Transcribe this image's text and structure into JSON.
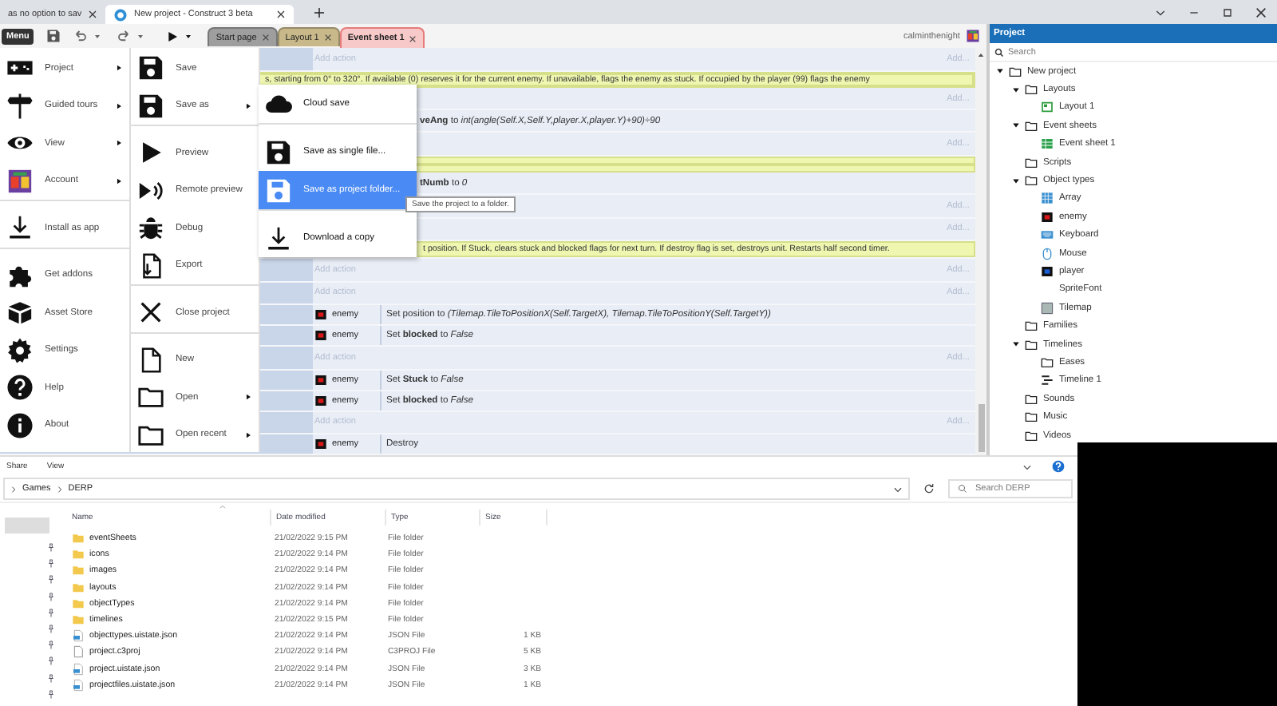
{
  "browser": {
    "tabs": [
      {
        "title": "as no option to sav",
        "selected": false
      },
      {
        "title": "New project - Construct 3 beta",
        "selected": true
      }
    ]
  },
  "toolbar": {
    "menu_label": "Menu",
    "user": "calminthenight",
    "tabs": [
      {
        "label": "Start page",
        "color": "#9e9e9e",
        "selected": false
      },
      {
        "label": "Layout 1",
        "color": "#c9b98a",
        "selected": false
      },
      {
        "label": "Event sheet 1",
        "color": "#f8c9c9",
        "selected": true
      }
    ]
  },
  "event_sheet": {
    "rows": [
      {
        "kind": "add",
        "label": "Add action",
        "more": "Add..."
      },
      {
        "kind": "comment",
        "text": "s, starting from 0° to 320°. If available (0) reserves it for the current enemy. If unavailable, flags the enemy as stuck. If occupied by the player (99) flags the enemy"
      },
      {
        "kind": "add",
        "more": "Add..."
      },
      {
        "kind": "action_clipped",
        "text": "**veAng** to *int(angle(Self.X,Self.Y,player.X,player.Y)+90)÷90*"
      },
      {
        "kind": "add",
        "more": "Add..."
      },
      {
        "kind": "comment"
      },
      {
        "kind": "action_clipped",
        "text": "**tNumb** to *0*"
      },
      {
        "kind": "add",
        "more": "Add..."
      },
      {
        "kind": "add",
        "more": "Add..."
      },
      {
        "kind": "comment_clipped",
        "text": "t position. If Stuck, clears stuck and blocked flags for next turn. If destroy flag is set, destroys unit. Restarts half second timer."
      },
      {
        "kind": "add",
        "label": "Add action",
        "more": "Add..."
      },
      {
        "kind": "add",
        "label": "Add action",
        "more": "Add..."
      },
      {
        "kind": "action",
        "object": "enemy",
        "text": "Set position to *(Tilemap.TileToPositionX(Self.TargetX), Tilemap.TileToPositionY(Self.TargetY))*"
      },
      {
        "kind": "action",
        "object": "enemy",
        "text": "Set **blocked** to *False*"
      },
      {
        "kind": "add",
        "label": "Add action",
        "more": "Add..."
      },
      {
        "kind": "action",
        "object": "enemy",
        "text": "Set **Stuck** to *False*"
      },
      {
        "kind": "action",
        "object": "enemy",
        "text": "Set **blocked** to *False*"
      },
      {
        "kind": "add",
        "label": "Add action",
        "more": "Add..."
      },
      {
        "kind": "action",
        "object": "enemy",
        "text": "Destroy"
      }
    ]
  },
  "main_menu": [
    {
      "label": "Project",
      "has_submenu": true
    },
    {
      "label": "Guided tours",
      "has_submenu": true
    },
    {
      "label": "View",
      "has_submenu": true
    },
    {
      "label": "Account",
      "has_submenu": true,
      "divider_after": true
    },
    {
      "label": "Install as app",
      "divider_after": true
    },
    {
      "label": "Get addons"
    },
    {
      "label": "Asset Store"
    },
    {
      "label": "Settings"
    },
    {
      "label": "Help"
    },
    {
      "label": "About"
    }
  ],
  "file_menu": [
    {
      "label": "Save"
    },
    {
      "label": "Save as",
      "has_submenu": true,
      "divider_after": true
    },
    {
      "label": "Preview"
    },
    {
      "label": "Remote preview"
    },
    {
      "label": "Debug"
    },
    {
      "label": "Export",
      "divider_after": true
    },
    {
      "label": "Close project",
      "divider_after": true
    },
    {
      "label": "New"
    },
    {
      "label": "Open",
      "has_submenu": true
    },
    {
      "label": "Open recent",
      "has_submenu": true
    }
  ],
  "save_as_menu": [
    {
      "label": "Cloud save",
      "selected": false,
      "divider_after": true
    },
    {
      "label": "Save as single file...",
      "selected": false
    },
    {
      "label": "Save as project folder...",
      "selected": true,
      "divider_after": true
    },
    {
      "label": "Download a copy",
      "selected": false
    }
  ],
  "tooltip": "Save the project to a folder.",
  "project_panel": {
    "title": "Project",
    "search_placeholder": "Search",
    "tree": [
      {
        "label": "New project",
        "kind": "folder",
        "expanded": true,
        "children": [
          {
            "label": "Layouts",
            "kind": "folder",
            "expanded": true,
            "children": [
              {
                "label": "Layout 1",
                "kind": "layout"
              }
            ]
          },
          {
            "label": "Event sheets",
            "kind": "folder",
            "expanded": true,
            "children": [
              {
                "label": "Event sheet 1",
                "kind": "eventsheet"
              }
            ]
          },
          {
            "label": "Scripts",
            "kind": "folder"
          },
          {
            "label": "Object types",
            "kind": "folder",
            "expanded": true,
            "children": [
              {
                "label": "Array",
                "kind": "array"
              },
              {
                "label": "enemy",
                "kind": "sprite",
                "color": "#d81818"
              },
              {
                "label": "Keyboard",
                "kind": "keyboard"
              },
              {
                "label": "Mouse",
                "kind": "mouse"
              },
              {
                "label": "player",
                "kind": "sprite",
                "color": "#1a5fd8"
              },
              {
                "label": "SpriteFont",
                "kind": "spritefont"
              },
              {
                "label": "Tilemap",
                "kind": "tilemap"
              }
            ]
          },
          {
            "label": "Families",
            "kind": "folder"
          },
          {
            "label": "Timelines",
            "kind": "folder",
            "expanded": true,
            "children": [
              {
                "label": "Eases",
                "kind": "folder"
              },
              {
                "label": "Timeline 1",
                "kind": "timeline"
              }
            ]
          },
          {
            "label": "Sounds",
            "kind": "folder"
          },
          {
            "label": "Music",
            "kind": "folder"
          },
          {
            "label": "Videos",
            "kind": "folder"
          }
        ]
      }
    ]
  },
  "explorer": {
    "ribbon": [
      "Share",
      "View"
    ],
    "path": [
      "Games",
      "DERP"
    ],
    "search_placeholder": "Search DERP",
    "columns": [
      "Name",
      "Date modified",
      "Type",
      "Size"
    ],
    "rows": [
      {
        "name": "eventSheets",
        "date": "21/02/2022 9:15 PM",
        "type": "File folder",
        "kind": "folder"
      },
      {
        "name": "icons",
        "date": "21/02/2022 9:14 PM",
        "type": "File folder",
        "kind": "folder"
      },
      {
        "name": "images",
        "date": "21/02/2022 9:14 PM",
        "type": "File folder",
        "kind": "folder"
      },
      {
        "name": "layouts",
        "date": "21/02/2022 9:14 PM",
        "type": "File folder",
        "kind": "folder"
      },
      {
        "name": "objectTypes",
        "date": "21/02/2022 9:14 PM",
        "type": "File folder",
        "kind": "folder"
      },
      {
        "name": "timelines",
        "date": "21/02/2022 9:15 PM",
        "type": "File folder",
        "kind": "folder"
      },
      {
        "name": "objecttypes.uistate.json",
        "date": "21/02/2022 9:14 PM",
        "type": "JSON File",
        "size": "1 KB",
        "kind": "json"
      },
      {
        "name": "project.c3proj",
        "date": "21/02/2022 9:14 PM",
        "type": "C3PROJ File",
        "size": "5 KB",
        "kind": "file"
      },
      {
        "name": "project.uistate.json",
        "date": "21/02/2022 9:14 PM",
        "type": "JSON File",
        "size": "3 KB",
        "kind": "json"
      },
      {
        "name": "projectfiles.uistate.json",
        "date": "21/02/2022 9:14 PM",
        "type": "JSON File",
        "size": "1 KB",
        "kind": "json"
      }
    ]
  }
}
